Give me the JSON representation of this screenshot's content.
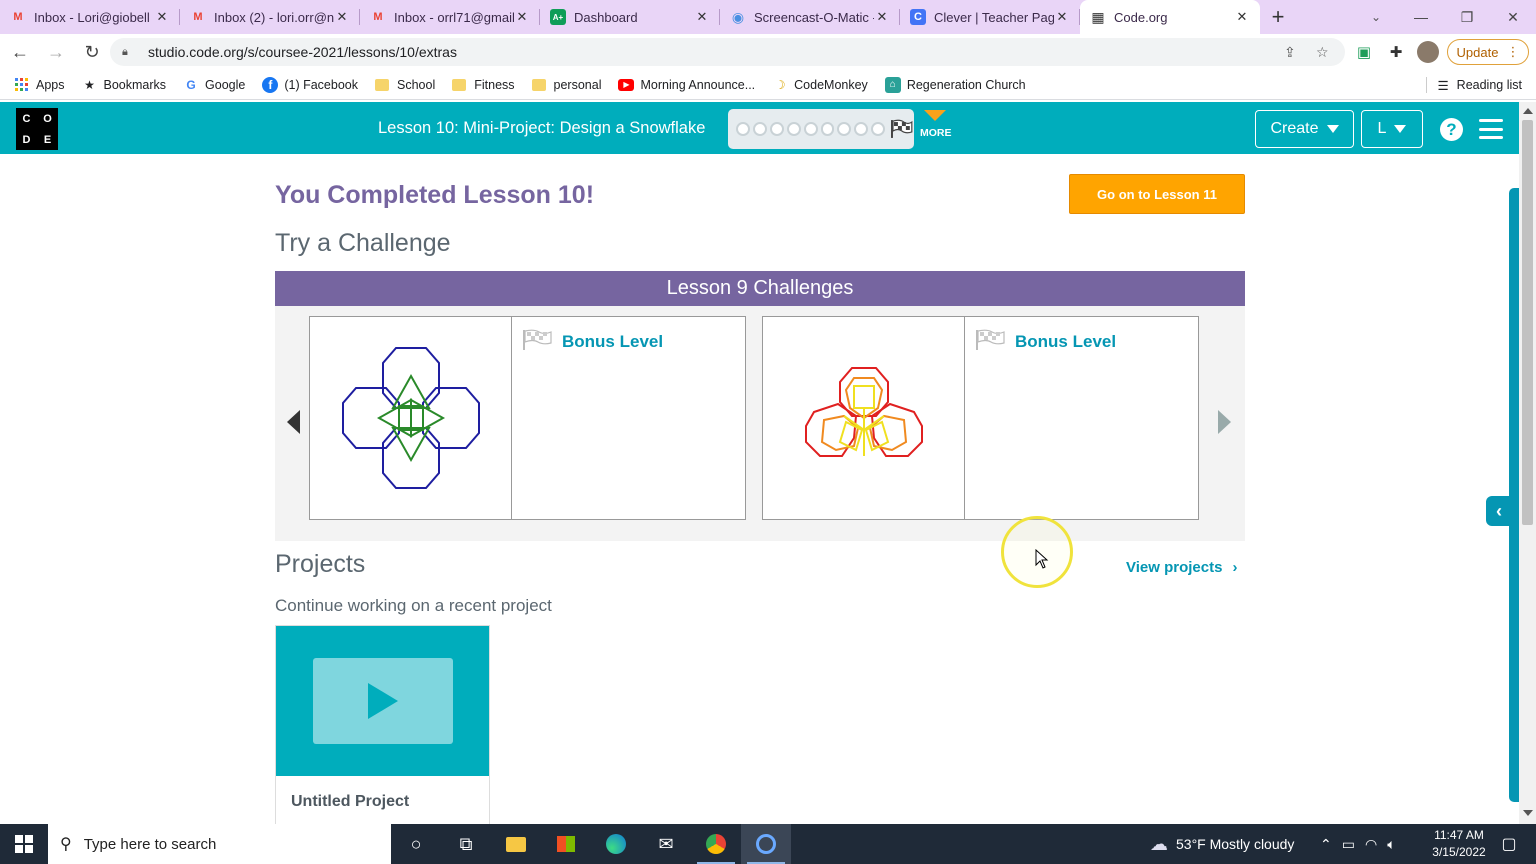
{
  "browser": {
    "tabs": [
      {
        "title": "Inbox - Lori@giobell",
        "icon": "gmail-icon",
        "color": "#ea4335",
        "glyph": "M"
      },
      {
        "title": "Inbox (2) - lori.orr@n",
        "icon": "gmail-icon",
        "color": "#ea4335",
        "glyph": "M"
      },
      {
        "title": "Inbox - orrl71@gmail",
        "icon": "gmail-icon",
        "color": "#ea4335",
        "glyph": "M"
      },
      {
        "title": "Dashboard",
        "icon": "dashboard-icon",
        "color": "#0f9d58",
        "glyph": "A+"
      },
      {
        "title": "Screencast-O-Matic -",
        "icon": "screencast-icon",
        "color": "#4a90e2",
        "glyph": "◉"
      },
      {
        "title": "Clever | Teacher Page",
        "icon": "clever-icon",
        "color": "#4274f6",
        "glyph": "C"
      },
      {
        "title": "Code.org",
        "icon": "codeorg-icon",
        "color": "#333",
        "glyph": "▦"
      }
    ],
    "new_tab": "+",
    "url": "studio.code.org/s/coursee-2021/lessons/10/extras",
    "update_label": "Update",
    "bookmarks": [
      {
        "label": "Apps",
        "icon": "apps-grid-icon"
      },
      {
        "label": "Bookmarks",
        "icon": "star-icon"
      },
      {
        "label": "Google",
        "icon": "google-icon"
      },
      {
        "label": "(1) Facebook",
        "icon": "facebook-icon"
      },
      {
        "label": "School",
        "icon": "folder-icon"
      },
      {
        "label": "Fitness",
        "icon": "folder-icon"
      },
      {
        "label": "personal",
        "icon": "folder-icon"
      },
      {
        "label": "Morning Announce...",
        "icon": "youtube-icon"
      },
      {
        "label": "CodeMonkey",
        "icon": "banana-icon"
      },
      {
        "label": "Regeneration Church",
        "icon": "church-icon"
      }
    ],
    "reading_list": "Reading list"
  },
  "header": {
    "logo_letters": [
      "C",
      "O",
      "D",
      "E"
    ],
    "lesson_title": "Lesson 10: Mini-Project: Design a Snowflake",
    "more_label": "MORE",
    "create_label": "Create",
    "user_label": "L",
    "help_glyph": "?"
  },
  "main": {
    "completed_title": "You Completed Lesson 10!",
    "next_button": "Go on to Lesson 11",
    "try_challenge": "Try a Challenge",
    "challenges_header": "Lesson 9 Challenges",
    "challenges": [
      {
        "label": "Bonus Level"
      },
      {
        "label": "Bonus Level"
      }
    ],
    "projects_title": "Projects",
    "view_projects": "View projects",
    "continue_text": "Continue working on a recent project",
    "project_name": "Untitled Project"
  },
  "taskbar": {
    "search_placeholder": "Type here to search",
    "weather": "53°F  Mostly cloudy",
    "time": "11:47 AM",
    "date": "3/15/2022"
  },
  "colors": {
    "codeorg_teal": "#00adbc",
    "purple": "#7665a0",
    "orange": "#ffa400",
    "link_blue": "#0596b3"
  }
}
